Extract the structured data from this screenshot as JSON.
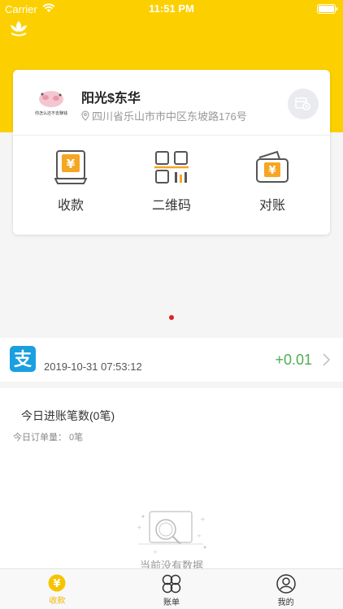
{
  "status_bar": {
    "carrier": "Carrier",
    "time": "11:51 PM"
  },
  "store": {
    "avatar_caption": "你怎么还不去赚钱",
    "name": "阳光$东华",
    "address": "四川省乐山市市中区东坡路176号"
  },
  "actions": [
    {
      "label": "收款",
      "icon": "cash-register-icon"
    },
    {
      "label": "二维码",
      "icon": "qrcode-icon"
    },
    {
      "label": "对账",
      "icon": "wallet-icon"
    }
  ],
  "carousel": {
    "current_page": 1
  },
  "transaction": {
    "channel_icon": "alipay-icon",
    "time": "2019-10-31 07:53:12",
    "amount": "+0.01"
  },
  "summary": {
    "title": "今日进账笔数(0笔)",
    "order_count": "今日订单量： 0笔",
    "empty_text": "当前没有数据"
  },
  "tabs": [
    {
      "label": "收款",
      "active": true
    },
    {
      "label": "账单",
      "active": false
    },
    {
      "label": "我的",
      "active": false
    }
  ],
  "colors": {
    "brand_yellow": "#fcd000",
    "amount_green": "#4caf50",
    "tab_active": "#f2b400",
    "action_icon_orange": "#f5a623",
    "alipay_blue": "#1a9fe0"
  }
}
